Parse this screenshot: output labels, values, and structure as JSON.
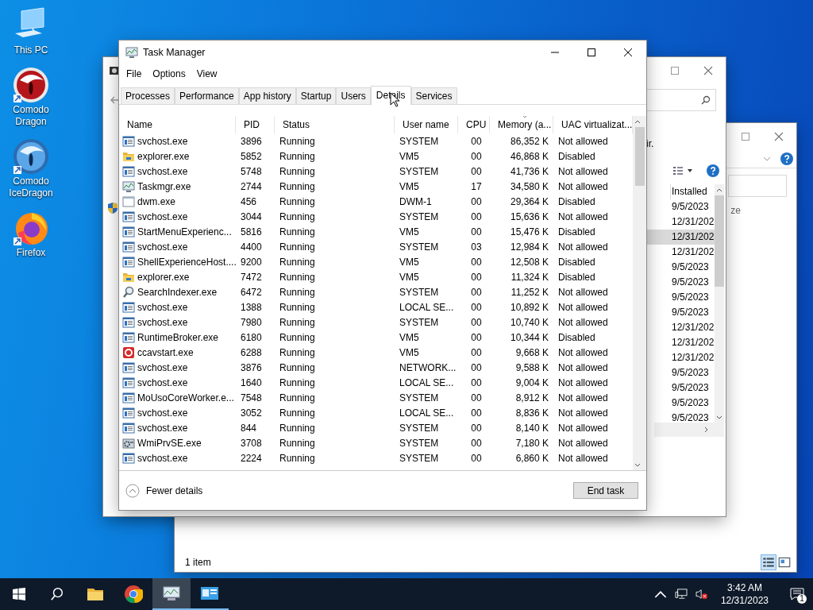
{
  "desktop": {
    "icons": [
      {
        "label": "This PC",
        "kind": "pc"
      },
      {
        "label": "Comodo Dragon",
        "kind": "dragon"
      },
      {
        "label": "Comodo IceDragon",
        "kind": "icedragon"
      },
      {
        "label": "Firefox",
        "kind": "firefox"
      }
    ]
  },
  "explorer_window": {
    "column_header": "ze",
    "status_bar": "1 item"
  },
  "programs_window": {
    "text_fragment": "ir.",
    "column_header": "Installed",
    "rows": [
      {
        "installed": "9/5/2023",
        "selected": false
      },
      {
        "installed": "12/31/202",
        "selected": false
      },
      {
        "installed": "12/31/202",
        "selected": true
      },
      {
        "installed": "12/31/202",
        "selected": false
      },
      {
        "installed": "9/5/2023",
        "selected": false
      },
      {
        "installed": "9/5/2023",
        "selected": false
      },
      {
        "installed": "9/5/2023",
        "selected": false
      },
      {
        "installed": "9/5/2023",
        "selected": false
      },
      {
        "installed": "12/31/202",
        "selected": false
      },
      {
        "installed": "12/31/202",
        "selected": false
      },
      {
        "installed": "12/31/202",
        "selected": false
      },
      {
        "installed": "9/5/2023",
        "selected": false
      },
      {
        "installed": "9/5/2023",
        "selected": false
      },
      {
        "installed": "9/5/2023",
        "selected": false
      },
      {
        "installed": "9/5/2023",
        "selected": false
      }
    ]
  },
  "task_manager": {
    "title": "Task Manager",
    "menu": [
      "File",
      "Options",
      "View"
    ],
    "tabs": [
      {
        "label": "Processes",
        "selected": false
      },
      {
        "label": "Performance",
        "selected": false
      },
      {
        "label": "App history",
        "selected": false
      },
      {
        "label": "Startup",
        "selected": false
      },
      {
        "label": "Users",
        "selected": false
      },
      {
        "label": "Details",
        "selected": true
      },
      {
        "label": "Services",
        "selected": false
      }
    ],
    "columns": [
      {
        "label": "Name",
        "sorted": false
      },
      {
        "label": "PID",
        "sorted": false
      },
      {
        "label": "Status",
        "sorted": false
      },
      {
        "label": "User name",
        "sorted": false
      },
      {
        "label": "CPU",
        "sorted": false
      },
      {
        "label": "Memory (a...",
        "sorted": true
      },
      {
        "label": "UAC virtualizat...",
        "sorted": false
      }
    ],
    "rows": [
      {
        "kind": "service",
        "name": "svchost.exe",
        "pid": "3896",
        "status": "Running",
        "user": "SYSTEM",
        "cpu": "00",
        "memory": "86,352 K",
        "uac": "Not allowed"
      },
      {
        "kind": "folder",
        "name": "explorer.exe",
        "pid": "5852",
        "status": "Running",
        "user": "VM5",
        "cpu": "00",
        "memory": "46,868 K",
        "uac": "Disabled"
      },
      {
        "kind": "service",
        "name": "svchost.exe",
        "pid": "5748",
        "status": "Running",
        "user": "SYSTEM",
        "cpu": "00",
        "memory": "41,736 K",
        "uac": "Not allowed"
      },
      {
        "kind": "monitor",
        "name": "Taskmgr.exe",
        "pid": "2744",
        "status": "Running",
        "user": "VM5",
        "cpu": "17",
        "memory": "34,580 K",
        "uac": "Not allowed"
      },
      {
        "kind": "window",
        "name": "dwm.exe",
        "pid": "456",
        "status": "Running",
        "user": "DWM-1",
        "cpu": "00",
        "memory": "29,364 K",
        "uac": "Disabled"
      },
      {
        "kind": "service",
        "name": "svchost.exe",
        "pid": "3044",
        "status": "Running",
        "user": "SYSTEM",
        "cpu": "00",
        "memory": "15,636 K",
        "uac": "Not allowed"
      },
      {
        "kind": "service",
        "name": "StartMenuExperienc...",
        "pid": "5816",
        "status": "Running",
        "user": "VM5",
        "cpu": "00",
        "memory": "15,476 K",
        "uac": "Disabled"
      },
      {
        "kind": "service",
        "name": "svchost.exe",
        "pid": "4400",
        "status": "Running",
        "user": "SYSTEM",
        "cpu": "03",
        "memory": "12,984 K",
        "uac": "Not allowed"
      },
      {
        "kind": "service",
        "name": "ShellExperienceHost....",
        "pid": "9200",
        "status": "Running",
        "user": "VM5",
        "cpu": "00",
        "memory": "12,508 K",
        "uac": "Disabled"
      },
      {
        "kind": "folder",
        "name": "explorer.exe",
        "pid": "7472",
        "status": "Running",
        "user": "VM5",
        "cpu": "00",
        "memory": "11,324 K",
        "uac": "Disabled"
      },
      {
        "kind": "search",
        "name": "SearchIndexer.exe",
        "pid": "6472",
        "status": "Running",
        "user": "SYSTEM",
        "cpu": "00",
        "memory": "11,252 K",
        "uac": "Not allowed"
      },
      {
        "kind": "service",
        "name": "svchost.exe",
        "pid": "1388",
        "status": "Running",
        "user": "LOCAL SE...",
        "cpu": "00",
        "memory": "10,892 K",
        "uac": "Not allowed"
      },
      {
        "kind": "service",
        "name": "svchost.exe",
        "pid": "7980",
        "status": "Running",
        "user": "SYSTEM",
        "cpu": "00",
        "memory": "10,740 K",
        "uac": "Not allowed"
      },
      {
        "kind": "service",
        "name": "RuntimeBroker.exe",
        "pid": "6180",
        "status": "Running",
        "user": "VM5",
        "cpu": "00",
        "memory": "10,344 K",
        "uac": "Disabled"
      },
      {
        "kind": "badge",
        "name": "ccavstart.exe",
        "pid": "6288",
        "status": "Running",
        "user": "VM5",
        "cpu": "00",
        "memory": "9,668 K",
        "uac": "Not allowed"
      },
      {
        "kind": "service",
        "name": "svchost.exe",
        "pid": "3876",
        "status": "Running",
        "user": "NETWORK...",
        "cpu": "00",
        "memory": "9,588 K",
        "uac": "Not allowed"
      },
      {
        "kind": "service",
        "name": "svchost.exe",
        "pid": "1640",
        "status": "Running",
        "user": "LOCAL SE...",
        "cpu": "00",
        "memory": "9,004 K",
        "uac": "Not allowed"
      },
      {
        "kind": "service",
        "name": "MoUsoCoreWorker.e...",
        "pid": "7548",
        "status": "Running",
        "user": "SYSTEM",
        "cpu": "00",
        "memory": "8,912 K",
        "uac": "Not allowed"
      },
      {
        "kind": "service",
        "name": "svchost.exe",
        "pid": "3052",
        "status": "Running",
        "user": "LOCAL SE...",
        "cpu": "00",
        "memory": "8,836 K",
        "uac": "Not allowed"
      },
      {
        "kind": "service",
        "name": "svchost.exe",
        "pid": "844",
        "status": "Running",
        "user": "SYSTEM",
        "cpu": "00",
        "memory": "8,140 K",
        "uac": "Not allowed"
      },
      {
        "kind": "gear",
        "name": "WmiPrvSE.exe",
        "pid": "3708",
        "status": "Running",
        "user": "SYSTEM",
        "cpu": "00",
        "memory": "7,180 K",
        "uac": "Not allowed"
      },
      {
        "kind": "service",
        "name": "svchost.exe",
        "pid": "2224",
        "status": "Running",
        "user": "SYSTEM",
        "cpu": "00",
        "memory": "6,860 K",
        "uac": "Not allowed"
      }
    ],
    "fewer_details": "Fewer details",
    "end_task": "End task"
  },
  "taskbar": {
    "apps": [
      {
        "kind": "folder",
        "selected": false,
        "running": false
      },
      {
        "kind": "chrome",
        "selected": false,
        "running": false
      },
      {
        "kind": "monitor",
        "selected": true,
        "running": true
      },
      {
        "kind": "panel",
        "selected": false,
        "running": true
      }
    ],
    "time": "3:42 AM",
    "date": "12/31/2023",
    "notifications": "1"
  }
}
